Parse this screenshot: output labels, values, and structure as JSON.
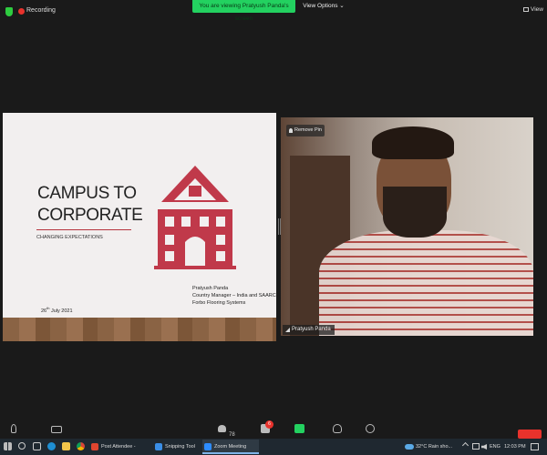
{
  "top_bar": {
    "recording_label": "Recording",
    "viewing_banner": "You are viewing Pratyush Panda's screen",
    "view_options_label": "View Options",
    "view_options_caret": "⌄",
    "view_label": "View"
  },
  "slide": {
    "title_line1": "CAMPUS TO",
    "title_line2": "CORPORATE",
    "subtitle": "CHANGING EXPECTATIONS",
    "date_prefix": "26",
    "date_suffix": "th",
    "date_rest": " July 2021",
    "presenter_name": "Pratyush Panda",
    "presenter_role": "Country Manager – India and SAARC",
    "presenter_company": "Forbo Flooring Systems"
  },
  "video": {
    "remove_pin_label": "Remove Pin",
    "participant_name": "Pratyush Panda"
  },
  "controls": {
    "participants_count": "78",
    "chat_badge": "6"
  },
  "taskbar": {
    "apps": [
      {
        "label": "Post Attendee - Zoo...",
        "color": "#e0452f"
      },
      {
        "label": "Snipping Tool",
        "color": "#3a8ee6"
      },
      {
        "label": "Zoom Meeting",
        "color": "#2d8cff"
      }
    ],
    "weather": "32°C  Rain sho...",
    "language": "ENG",
    "time": "12:03 PM"
  },
  "colors": {
    "accent_green": "#23d160",
    "record_red": "#e8322c",
    "slide_accent": "#b6353f"
  }
}
